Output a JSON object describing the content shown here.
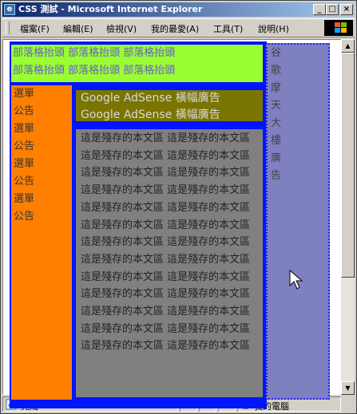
{
  "window": {
    "title": "CSS 測試 - Microsoft Internet Explorer",
    "controls": {
      "minimize": "_",
      "maximize": "□",
      "close": "×"
    }
  },
  "menu": {
    "items": [
      "檔案(F)",
      "編輯(E)",
      "檢視(V)",
      "我的最愛(A)",
      "工具(T)",
      "說明(H)"
    ]
  },
  "page": {
    "header_lines": [
      "部落格抬頭 部落格抬頭 部落格抬頭",
      "部落格抬頭 部落格抬頭 部落格抬頭"
    ],
    "sidebar_lines": [
      "選單",
      "公告",
      "選單",
      "公告",
      "選單",
      "公告",
      "選單",
      "公告"
    ],
    "ad_lines": [
      "Google AdSense 橫幅廣告",
      "Google AdSense 橫幅廣告"
    ],
    "main_text": "這是殘存的本文區 這是殘存的本文區 這是殘存的本文區 這是殘存的本文區 這是殘存的本文區 這是殘存的本文區 這是殘存的本文區 這是殘存的本文區 這是殘存的本文區 這是殘存的本文區 這是殘存的本文區 這是殘存的本文區 這是殘存的本文區 這是殘存的本文區 這是殘存的本文區 這是殘存的本文區 這是殘存的本文區 這是殘存的本文區 這是殘存的本文區 這是殘存的本文區 這是殘存的本文區 這是殘存的本文區 這是殘存的本文區 這是殘存的本文區 這是殘存的本文區 這是殘存的本文區",
    "right_text": "谷歌摩天大樓廣告"
  },
  "status": {
    "text": "完成",
    "zone": "我的電腦"
  },
  "colors": {
    "header_bg": "#99ff33",
    "sidebar_bg": "#ff8000",
    "ad_bg": "#7a7500",
    "main_bg": "#808080",
    "right_bg": "#7f80c0",
    "border_blue": "#0014ff"
  },
  "icons": [
    "ie-app-icon",
    "windows-logo-icon",
    "page-done-icon",
    "computer-icon",
    "mouse-pointer-icon"
  ]
}
